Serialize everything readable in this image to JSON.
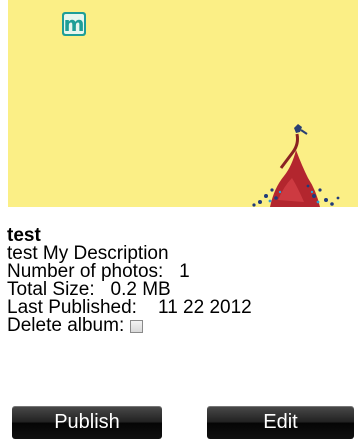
{
  "album": {
    "name": "test",
    "description": "test My Description",
    "photos_label": "Number of photos:",
    "photos_value": "1",
    "size_label": "Total Size:",
    "size_value": "0.2 MB",
    "published_label": "Last Published:",
    "published_value": "11 22 2012",
    "delete_label": "Delete album:",
    "delete_checked": false
  },
  "thumbnail": {
    "background_color": "#fbef86",
    "logo_letter": "m",
    "logo_color": "#1e9e97"
  },
  "actions": {
    "publish_label": "Publish",
    "edit_label": "Edit"
  }
}
